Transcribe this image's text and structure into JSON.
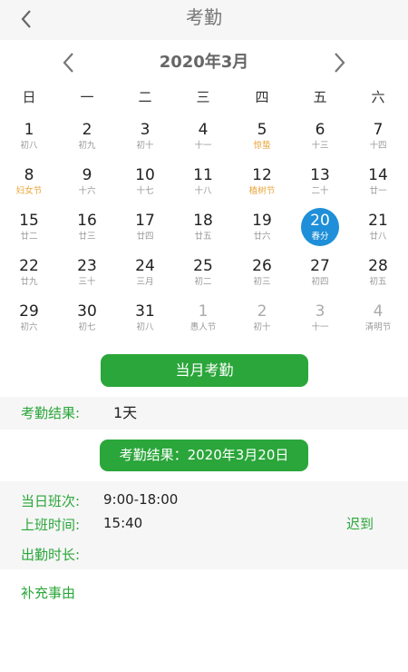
{
  "header": {
    "title": "考勤",
    "back_icon": "chevron-left-icon"
  },
  "calendar": {
    "month_title": "2020年3月",
    "prev_icon": "chevron-left-icon",
    "next_icon": "chevron-right-icon",
    "weekdays": [
      "日",
      "一",
      "二",
      "三",
      "四",
      "五",
      "六"
    ],
    "weeks": [
      [
        {
          "n": "1",
          "s": "初八"
        },
        {
          "n": "2",
          "s": "初九"
        },
        {
          "n": "3",
          "s": "初十"
        },
        {
          "n": "4",
          "s": "十一"
        },
        {
          "n": "5",
          "s": "惊蛰",
          "festival": true
        },
        {
          "n": "6",
          "s": "十三"
        },
        {
          "n": "7",
          "s": "十四"
        }
      ],
      [
        {
          "n": "8",
          "s": "妇女节",
          "festival": true
        },
        {
          "n": "9",
          "s": "十六"
        },
        {
          "n": "10",
          "s": "十七"
        },
        {
          "n": "11",
          "s": "十八"
        },
        {
          "n": "12",
          "s": "植树节",
          "festival": true
        },
        {
          "n": "13",
          "s": "二十"
        },
        {
          "n": "14",
          "s": "廿一"
        }
      ],
      [
        {
          "n": "15",
          "s": "廿二"
        },
        {
          "n": "16",
          "s": "廿三"
        },
        {
          "n": "17",
          "s": "廿四"
        },
        {
          "n": "18",
          "s": "廿五"
        },
        {
          "n": "19",
          "s": "廿六"
        },
        {
          "n": "20",
          "s": "春分",
          "selected": true
        },
        {
          "n": "21",
          "s": "廿八"
        }
      ],
      [
        {
          "n": "22",
          "s": "廿九"
        },
        {
          "n": "23",
          "s": "三十"
        },
        {
          "n": "24",
          "s": "三月"
        },
        {
          "n": "25",
          "s": "初二"
        },
        {
          "n": "26",
          "s": "初三"
        },
        {
          "n": "27",
          "s": "初四"
        },
        {
          "n": "28",
          "s": "初五"
        }
      ],
      [
        {
          "n": "29",
          "s": "初六"
        },
        {
          "n": "30",
          "s": "初七"
        },
        {
          "n": "31",
          "s": "初八"
        },
        {
          "n": "1",
          "s": "愚人节",
          "other": true
        },
        {
          "n": "2",
          "s": "初十",
          "other": true
        },
        {
          "n": "3",
          "s": "十一",
          "other": true
        },
        {
          "n": "4",
          "s": "清明节",
          "other": true
        }
      ]
    ]
  },
  "month_button": {
    "label": "当月考勤"
  },
  "result": {
    "label": "考勤结果:",
    "value": "1天"
  },
  "date_button": {
    "label": "考勤结果：2020年3月20日"
  },
  "detail": {
    "shift_label": "当日班次:",
    "shift_value": "9:00-18:00",
    "clock_in_label": "上班时间:",
    "clock_in_value": "15:40",
    "duration_label": "出勤时长:",
    "status": "迟到"
  },
  "supplement": {
    "label": "补充事由"
  },
  "colors": {
    "accent_green": "#2aa63a",
    "selected_blue": "#1e8fd8",
    "festival_orange": "#e8a43a"
  }
}
